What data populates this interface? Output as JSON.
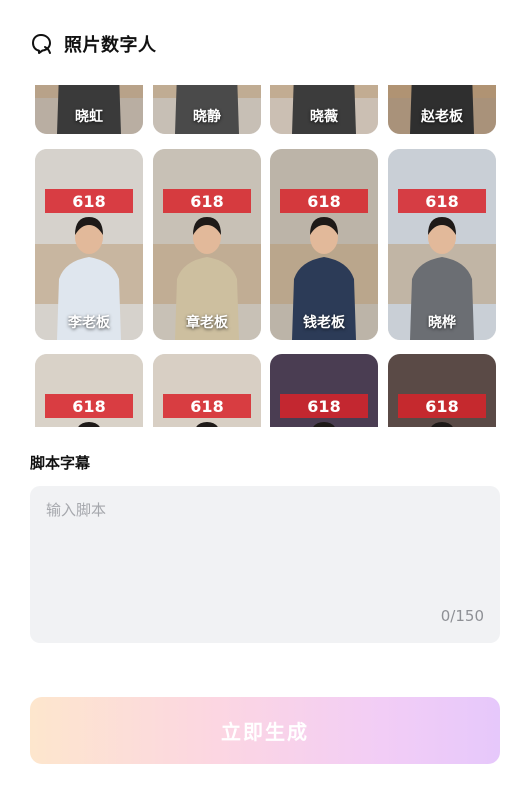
{
  "header": {
    "title": "照片数字人",
    "icon": "avatar-bubble-icon"
  },
  "avatars": [
    {
      "name": "晓虹",
      "row": 0,
      "col": 0
    },
    {
      "name": "晓静",
      "row": 0,
      "col": 1
    },
    {
      "name": "晓薇",
      "row": 0,
      "col": 2
    },
    {
      "name": "赵老板",
      "row": 0,
      "col": 3
    },
    {
      "name": "李老板",
      "row": 1,
      "col": 0
    },
    {
      "name": "章老板",
      "row": 1,
      "col": 1
    },
    {
      "name": "钱老板",
      "row": 1,
      "col": 2
    },
    {
      "name": "晓桦",
      "row": 1,
      "col": 3
    },
    {
      "name": "",
      "row": 2,
      "col": 0
    },
    {
      "name": "",
      "row": 2,
      "col": 1
    },
    {
      "name": "",
      "row": 2,
      "col": 2
    },
    {
      "name": "",
      "row": 2,
      "col": 3
    }
  ],
  "promo_text": "618",
  "script": {
    "section_title": "脚本字幕",
    "placeholder": "输入脚本",
    "value": "",
    "counter": "0/150"
  },
  "generate_button": {
    "label": "立即生成"
  },
  "colors": {
    "brand_red": "#d8232a",
    "input_bg": "#f1f2f4",
    "button_gradient_start": "#fde6cd",
    "button_gradient_end": "#e6c8fb"
  }
}
